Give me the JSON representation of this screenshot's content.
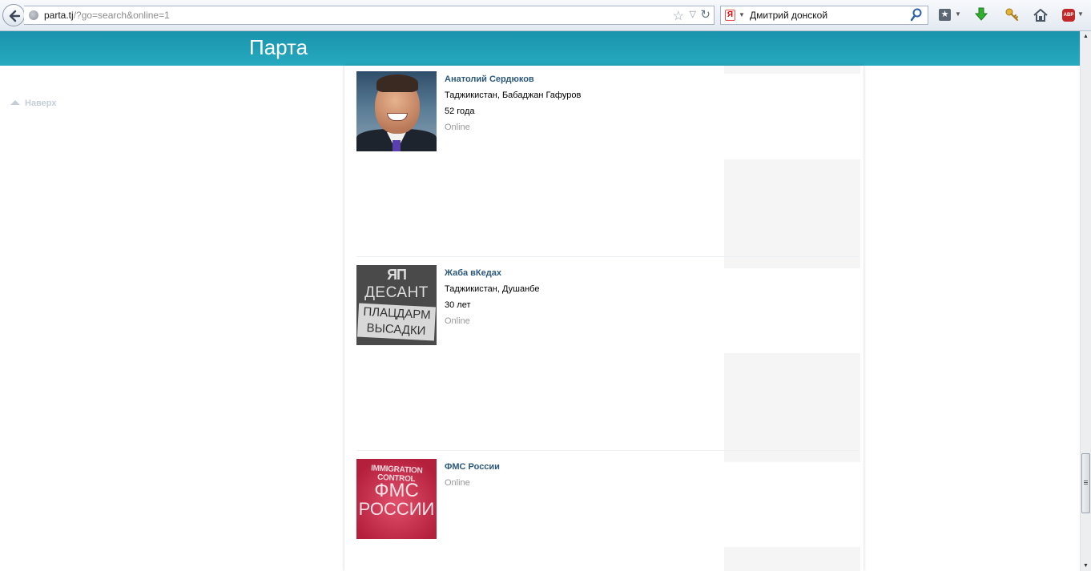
{
  "browser": {
    "url_host": "parta.tj",
    "url_path": "/?go=search&online=1",
    "search_engine_icon": "Я",
    "search_query": "Дмитрий донской",
    "icons": [
      "back-arrow-icon",
      "globe-icon",
      "star-icon",
      "dropdown-arrow-icon",
      "reload-icon",
      "search-icon",
      "bookmarks-icon",
      "download-icon",
      "key-icon",
      "home-icon",
      "adblock-icon"
    ],
    "adblock_label": "ABP"
  },
  "site": {
    "logo": "Парта",
    "back_to_top": "Наверх",
    "header_color": "#1e9db5",
    "link_color": "#2b587a"
  },
  "results": [
    {
      "name": "Анатолий Сердюков",
      "location": "Таджикистан, Бабаджан Гафуров",
      "age": "52 года",
      "status": "Online"
    },
    {
      "name": "Жаба вКедах",
      "location": "Таджикистан, Душанбе",
      "age": "30 лет",
      "status": "Online",
      "photo_text": {
        "emblem": "ЯП",
        "line1": "ДЕСАНТ",
        "line2": "ПЛАЦДАРМ",
        "line3": "ВЫСАДКИ"
      }
    },
    {
      "name": "ФМС России",
      "status": "Online",
      "photo_text": {
        "line1": "IMMIGRATION CONTROL",
        "line2": "ФМС",
        "line3": "РОССИИ"
      }
    }
  ]
}
